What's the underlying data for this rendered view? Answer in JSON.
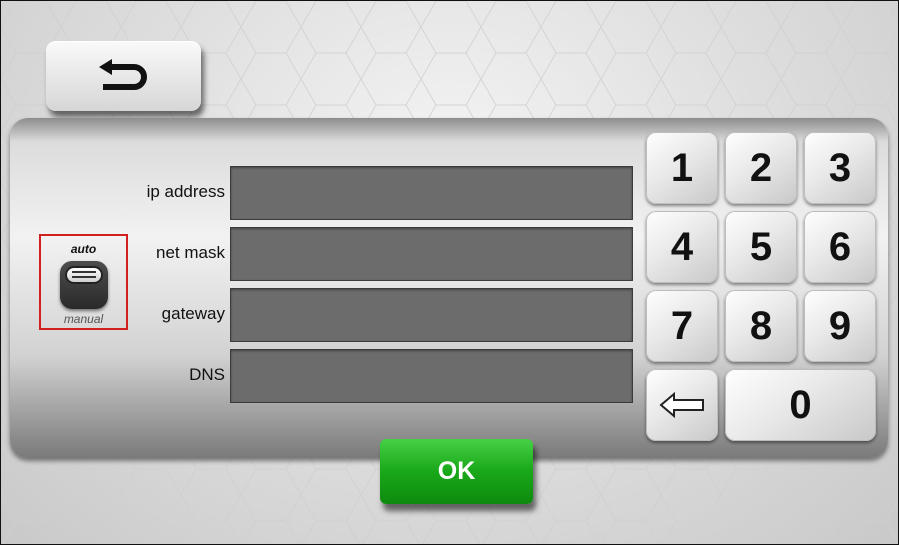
{
  "form": {
    "fields": [
      {
        "label": "ip address",
        "value": ""
      },
      {
        "label": "net mask",
        "value": ""
      },
      {
        "label": "gateway",
        "value": ""
      },
      {
        "label": "DNS",
        "value": ""
      }
    ]
  },
  "mode_toggle": {
    "top_label": "auto",
    "bottom_label": "manual"
  },
  "keypad": {
    "keys": [
      "1",
      "2",
      "3",
      "4",
      "5",
      "6",
      "7",
      "8",
      "9",
      "0"
    ],
    "backspace_icon": "left-arrow-icon"
  },
  "back_button": {
    "icon": "back-arrow-icon"
  },
  "ok_button": {
    "label": "OK"
  },
  "colors": {
    "accent": "#19a819",
    "field_bg": "#6c6c6c",
    "highlight": "#d12020"
  }
}
